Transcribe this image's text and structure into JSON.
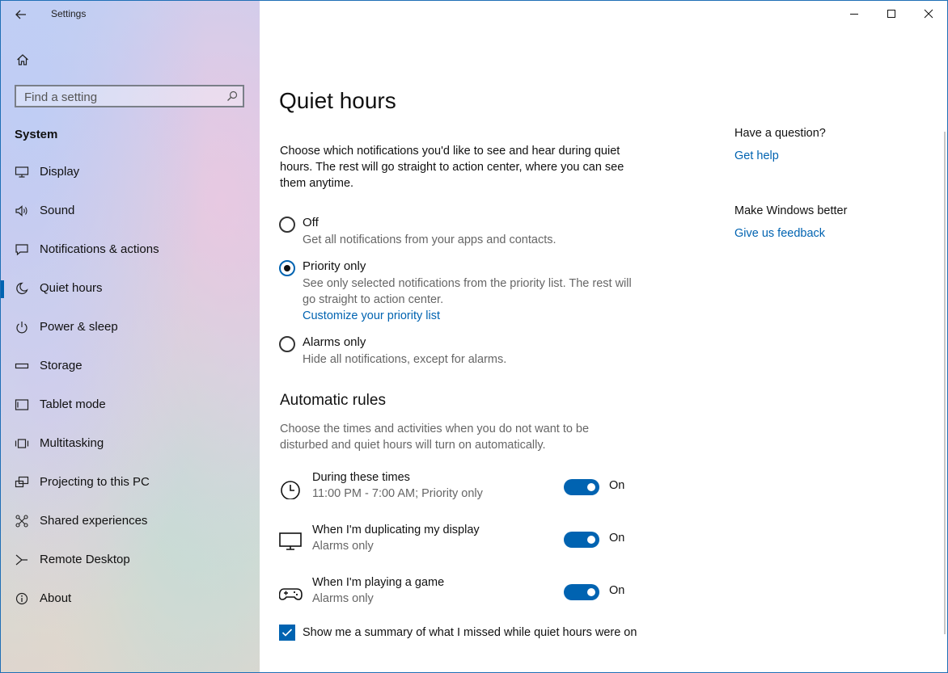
{
  "window": {
    "app_title": "Settings",
    "accent": "#0063b1"
  },
  "sidebar": {
    "search_placeholder": "Find a setting",
    "section_title": "System",
    "items": [
      {
        "label": "Display",
        "icon": "monitor-icon",
        "selected": false
      },
      {
        "label": "Sound",
        "icon": "speaker-icon",
        "selected": false
      },
      {
        "label": "Notifications & actions",
        "icon": "message-icon",
        "selected": false
      },
      {
        "label": "Quiet hours",
        "icon": "moon-icon",
        "selected": true
      },
      {
        "label": "Power & sleep",
        "icon": "power-icon",
        "selected": false
      },
      {
        "label": "Storage",
        "icon": "storage-icon",
        "selected": false
      },
      {
        "label": "Tablet mode",
        "icon": "tablet-icon",
        "selected": false
      },
      {
        "label": "Multitasking",
        "icon": "multitask-icon",
        "selected": false
      },
      {
        "label": "Projecting to this PC",
        "icon": "project-icon",
        "selected": false
      },
      {
        "label": "Shared experiences",
        "icon": "share-icon",
        "selected": false
      },
      {
        "label": "Remote Desktop",
        "icon": "remote-icon",
        "selected": false
      },
      {
        "label": "About",
        "icon": "info-icon",
        "selected": false
      }
    ]
  },
  "main": {
    "title": "Quiet hours",
    "description": "Choose which notifications you'd like to see and hear during quiet hours. The rest will go straight to action center, where you can see them anytime.",
    "options": [
      {
        "label": "Off",
        "description": "Get all notifications from your apps and contacts.",
        "checked": false
      },
      {
        "label": "Priority only",
        "description": "See only selected notifications from the priority list. The rest will go straight to action center.",
        "link": "Customize your priority list",
        "checked": true
      },
      {
        "label": "Alarms only",
        "description": "Hide all notifications, except for alarms.",
        "checked": false
      }
    ],
    "rules_title": "Automatic rules",
    "rules_description": "Choose the times and activities when you do not want to be disturbed and quiet hours will turn on automatically.",
    "rules": [
      {
        "title": "During these times",
        "subtitle": "11:00 PM - 7:00 AM; Priority only",
        "state": "On",
        "icon": "clock-icon"
      },
      {
        "title": "When I'm duplicating my display",
        "subtitle": "Alarms only",
        "state": "On",
        "icon": "display-icon"
      },
      {
        "title": "When I'm playing a game",
        "subtitle": "Alarms only",
        "state": "On",
        "icon": "gamepad-icon"
      }
    ],
    "summary_checkbox": {
      "label": "Show me a summary of what I missed while quiet hours were on",
      "checked": true
    }
  },
  "aside": {
    "question": "Have a question?",
    "help_link": "Get help",
    "feedback_title": "Make Windows better",
    "feedback_link": "Give us feedback"
  }
}
